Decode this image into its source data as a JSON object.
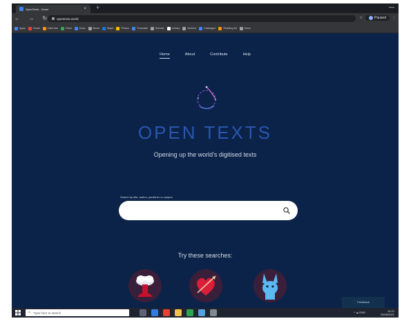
{
  "browser": {
    "tab_title": "OpenTexts - Home",
    "tab_close": "×",
    "new_tab": "+",
    "window_controls": "—",
    "nav_icons": "← → ↻",
    "url": "opentexts.world",
    "profile_label": "Paused",
    "bookmarks": [
      {
        "label": "Apps",
        "color": "#4285f4"
      },
      {
        "label": "Gmail",
        "color": "#ea4335"
      },
      {
        "label": "Calendar",
        "color": "#f29900"
      },
      {
        "label": "Drive",
        "color": "#34a853"
      },
      {
        "label": "Docs",
        "color": "#4285f4"
      },
      {
        "label": "News",
        "color": "#9aa0a6"
      },
      {
        "label": "Maps",
        "color": "#1a73e8"
      },
      {
        "label": "Photos",
        "color": "#fbbc04"
      },
      {
        "label": "Translate",
        "color": "#4285f4"
      },
      {
        "label": "Scholar",
        "color": "#9aa0a6"
      },
      {
        "label": "Library",
        "color": "#ffffff"
      },
      {
        "label": "Archive",
        "color": "#9aa0a6"
      },
      {
        "label": "Catalogue",
        "color": "#4285f4"
      },
      {
        "label": "Reading list",
        "color": "#f29900"
      },
      {
        "label": "More",
        "color": "#9aa0a6"
      }
    ]
  },
  "nav": [
    {
      "label": "Home",
      "active": true
    },
    {
      "label": "About",
      "active": false
    },
    {
      "label": "Contribute",
      "active": false
    },
    {
      "label": "Help",
      "active": false
    }
  ],
  "brand": "OPEN TEXTS",
  "tagline": "Opening up the world's digitised texts",
  "search": {
    "label": "Search by title, author, publisher or subject",
    "placeholder": ""
  },
  "try_heading": "Try these searches:",
  "features": [
    {
      "name": "mushroom-cloud",
      "bg": "#3a1f3a"
    },
    {
      "name": "heart-arrow",
      "bg": "#3a1f3a"
    },
    {
      "name": "blue-rabbit",
      "bg": "#3a1f3a"
    }
  ],
  "popup_label": "Feedback",
  "taskbar": {
    "search_placeholder": "Type here to search",
    "tasks": [
      "#5f6673",
      "#2f7de1",
      "#e34234",
      "#f2c14e",
      "#2da44e",
      "#4fa3e0",
      "#7f8c8d"
    ],
    "tray_icons": "^ ☁ ENG",
    "time": "14:21",
    "date": "20/06/2021"
  },
  "colors": {
    "page_bg": "#0b2348",
    "brand": "#2a56b0"
  }
}
